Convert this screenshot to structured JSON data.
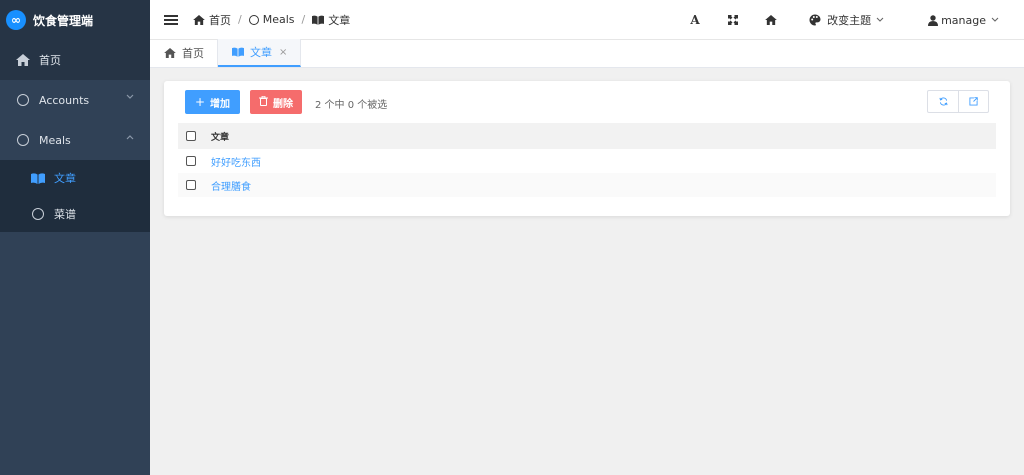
{
  "app": {
    "title": "饮食管理端",
    "logo_glyph": "∞"
  },
  "sidebar": {
    "items": [
      {
        "label": "首页",
        "icon": "home-icon"
      },
      {
        "label": "Accounts",
        "icon": "circle-icon"
      },
      {
        "label": "Meals",
        "icon": "circle-icon"
      }
    ],
    "meals_children": [
      {
        "label": "文章",
        "icon": "book-icon"
      },
      {
        "label": "菜谱",
        "icon": "circle-icon"
      }
    ]
  },
  "header": {
    "breadcrumb": [
      {
        "label": "首页",
        "icon": "home-icon"
      },
      {
        "label": "Meals",
        "icon": "circle-icon"
      },
      {
        "label": "文章",
        "icon": "book-icon"
      }
    ],
    "separator": "/",
    "font_tool": "A",
    "theme_label": "改变主题",
    "user_label": "manage"
  },
  "tabs": [
    {
      "label": "首页",
      "icon": "home-icon"
    },
    {
      "label": "文章",
      "icon": "book-icon",
      "close": "×"
    }
  ],
  "toolbar": {
    "add_label": "增加",
    "add_icon": "+",
    "delete_label": "删除",
    "selection_info": "2 个中 0 个被选"
  },
  "table": {
    "header": "文章",
    "rows": [
      "好好吃东西",
      "合理膳食"
    ]
  },
  "colors": {
    "sidebar_bg": "#304156",
    "primary": "#409eff",
    "danger": "#f56c6c"
  }
}
